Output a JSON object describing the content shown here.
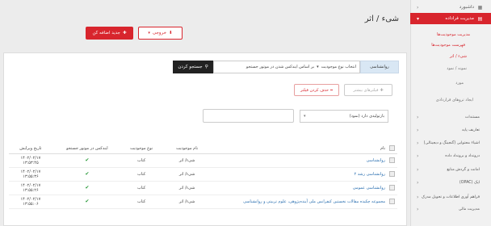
{
  "sidebar": {
    "items": [
      {
        "label": "داشبورد",
        "icon": "dashboard-icon",
        "top": 0
      },
      {
        "label": "مدیریت فراداده",
        "icon": "metadata-icon",
        "active": true
      }
    ],
    "sub": [
      {
        "label": "مدیریت موجودیت‌ها",
        "red": true
      },
      {
        "label": "فهرست موجودیت‌ها",
        "red": true
      },
      {
        "label": "شیء / اثر",
        "red": true
      },
      {
        "label": "نمونه / نمود",
        "red": false
      },
      {
        "label": "مورد",
        "red": false
      },
      {
        "label": "ایجاد تروهای قراردادی",
        "red": false
      }
    ],
    "lower": [
      {
        "label": "مستندات"
      },
      {
        "label": "تعاریف پایه"
      },
      {
        "label": "اشیاء محتوایی (گنجینگ و دیجیتالی)"
      },
      {
        "label": "درونداد و برونداد داده"
      },
      {
        "label": "امانت و گردش منابع"
      },
      {
        "label": "اپک (OPAC)"
      },
      {
        "label": "فراهم آوری اطلاعات و تحویل مدرک"
      },
      {
        "label": "مدیریت مالی"
      }
    ]
  },
  "header": {
    "title": "شیء / اثر",
    "new_label": "جدید اضافه کن",
    "export_label": "خروجی"
  },
  "search": {
    "field_label": "روانشناسی",
    "entity_select": "انتخاب نوع موجودیت",
    "index_select": "بر اساس ایندکس شدن در موتور جستجو",
    "go_label": "جستجو کردن"
  },
  "filters": {
    "add_label": "فیلترهای بیشتر",
    "clear_label": "حذف کردن فیلتر",
    "select_value": "بازتولیدی دارد (نمود)"
  },
  "table": {
    "headers": [
      "نام",
      "نام موجودیت",
      "نوع موجودیت",
      "ایندکس در موتور جستجو",
      "تاریخ ویرایش"
    ],
    "rows": [
      {
        "name": "روانشناسی",
        "entity": "شیء/ اثر",
        "type": "کتاب",
        "date1": "۱۴۰۲/۰۲/۱۷",
        "date2": "۱۳:۵۳:۴۵"
      },
      {
        "name": "روانشناسی رشد ۲",
        "entity": "شیء/ اثر",
        "type": "کتاب",
        "date1": "۱۴۰۲/۰۲/۱۷",
        "date2": "۱۳:۵۵:۳۶"
      },
      {
        "name": "روانشناسی عمومی",
        "entity": "شیء/ اثر",
        "type": "کتاب",
        "date1": "۱۴۰۲/۰۲/۱۷",
        "date2": "۱۳:۵۵:۲۶"
      },
      {
        "name": "مجموعه چکیده مقالات نخستین کنفرانس ملی آینده‌پژوهی، علوم تربیتی و روانشناسی",
        "entity": "شیء/ اثر",
        "type": "کتاب",
        "date1": "۱۴۰۲/۰۲/۱۷",
        "date2": "۱۳:۵۵:۰۶"
      }
    ]
  },
  "colors": {
    "accent": "#d8252d",
    "link": "#2a6fb0",
    "ok": "#2a9a3a"
  }
}
